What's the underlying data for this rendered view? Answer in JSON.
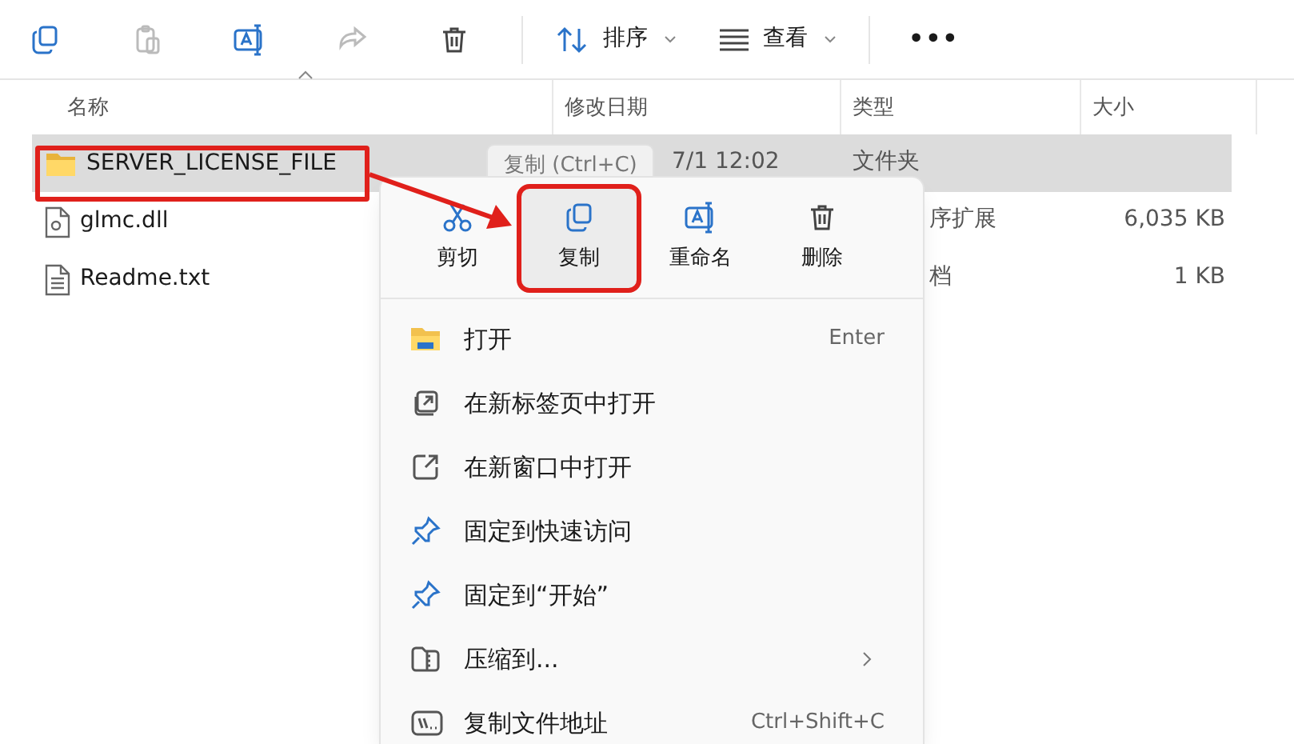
{
  "toolbar": {
    "buttons": [
      {
        "kind": "copy",
        "disabled": false
      },
      {
        "kind": "paste",
        "disabled": true
      },
      {
        "kind": "rename",
        "disabled": false
      },
      {
        "kind": "share",
        "disabled": true
      },
      {
        "kind": "delete",
        "disabled": false
      }
    ],
    "sort": {
      "label": "排序"
    },
    "view": {
      "label": "查看"
    },
    "more": "•••"
  },
  "columns": [
    "名称",
    "修改日期",
    "类型",
    "大小"
  ],
  "files": [
    {
      "name": "SERVER_LICENSE_FILE",
      "kind": "folder",
      "date": "7/1 12:02",
      "type": "文件夹",
      "selected": true
    },
    {
      "name": "glmc.dll",
      "kind": "dll",
      "type": "序扩展",
      "size": "6,035 KB",
      "selected": false
    },
    {
      "name": "Readme.txt",
      "kind": "text",
      "type": "档",
      "size": "1 KB",
      "selected": false
    }
  ],
  "tooltip": "复制 (Ctrl+C)",
  "context_menu": {
    "actions": [
      {
        "kind": "cut",
        "label": "剪切",
        "highlighted": false
      },
      {
        "kind": "copy",
        "label": "复制",
        "highlighted": true
      },
      {
        "kind": "rename",
        "label": "重命名",
        "highlighted": false
      },
      {
        "kind": "delete",
        "label": "删除",
        "highlighted": false
      }
    ],
    "items": [
      {
        "kind": "open",
        "label": "打开",
        "shortcut": "Enter",
        "submenu": false
      },
      {
        "kind": "tab",
        "label": "在新标签页中打开",
        "submenu": false
      },
      {
        "kind": "window",
        "label": "在新窗口中打开",
        "submenu": false
      },
      {
        "kind": "pin",
        "label": "固定到快速访问",
        "submenu": false
      },
      {
        "kind": "pin",
        "label": "固定到“开始”",
        "submenu": false
      },
      {
        "kind": "zip",
        "label": "压缩到...",
        "submenu": true
      },
      {
        "kind": "path",
        "label": "复制文件地址",
        "shortcut": "Ctrl+Shift+C",
        "submenu": false
      }
    ]
  }
}
